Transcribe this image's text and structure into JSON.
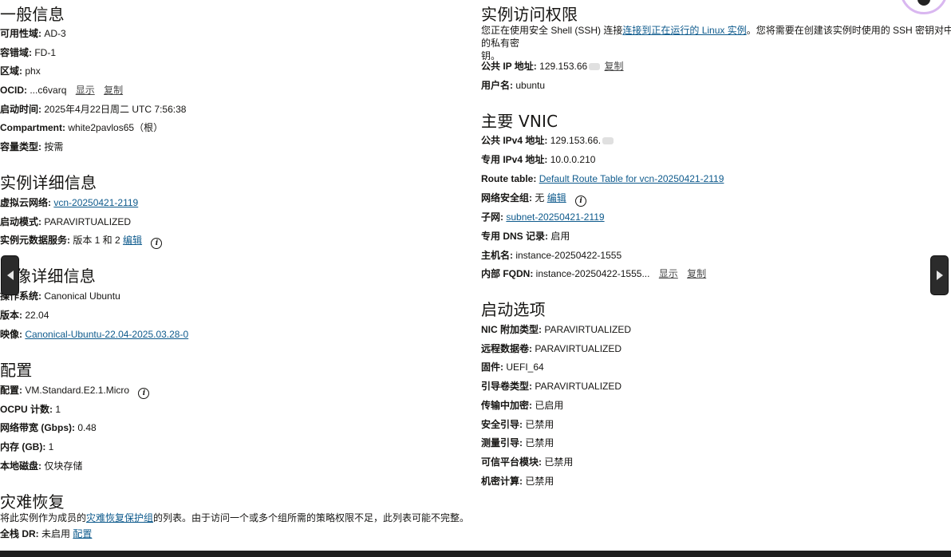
{
  "general": {
    "title": "一般信息",
    "availability_domain_label": "可用性域:",
    "availability_domain_value": "AD-3",
    "fault_domain_label": "容错域:",
    "fault_domain_value": "FD-1",
    "region_label": "区域:",
    "region_value": "phx",
    "ocid_label": "OCID:",
    "ocid_value": "...c6varq",
    "ocid_show": "显示",
    "ocid_copy": "复制",
    "launched_label": "启动时间:",
    "launched_value": "2025年4月22日周二 UTC 7:56:38",
    "compartment_label": "Compartment:",
    "compartment_value": "white2pavlos65（根）",
    "capacity_label": "容量类型:",
    "capacity_value": "按需"
  },
  "instance_details": {
    "title": "实例详细信息",
    "vcn_label": "虚拟云网络:",
    "vcn_value": "vcn-20250421-2119",
    "launch_mode_label": "启动模式:",
    "launch_mode_value": "PARAVIRTUALIZED",
    "metadata_label": "实例元数据服务:",
    "metadata_value": "版本 1 和 2",
    "metadata_edit": "编辑"
  },
  "image_details": {
    "title": "像详细信息",
    "os_label": "操作系统:",
    "os_value": "Canonical Ubuntu",
    "version_label": "版本:",
    "version_value": "22.04",
    "image_label": "映像:",
    "image_value": "Canonical-Ubuntu-22.04-2025.03.28-0"
  },
  "shape": {
    "title": "配置",
    "shape_label": "配置:",
    "shape_value": "VM.Standard.E2.1.Micro",
    "ocpu_label": "OCPU 计数:",
    "ocpu_value": "1",
    "bandwidth_label": "网络带宽 (Gbps):",
    "bandwidth_value": "0.48",
    "memory_label": "内存 (GB):",
    "memory_value": "1",
    "local_disk_label": "本地磁盘:",
    "local_disk_value": "仅块存储"
  },
  "disaster_recovery": {
    "title": "灾难恢复",
    "desc_before": "将此实例作为成员的",
    "desc_link": "灾难恢复保护组",
    "desc_after": "的列表。由于访问一个或多个组所需的策略权限不足，此列表可能不完整。",
    "fsdr_label": "全栈 DR:",
    "fsdr_value": "未启用",
    "fsdr_config": "配置"
  },
  "access": {
    "title": "实例访问权限",
    "desc_before": "您正在使用安全 Shell (SSH) 连接",
    "desc_link": "连接到正在运行的 Linux 实例",
    "desc_after": "。您将需要在创建该实例时使用的 SSH 密钥对中的私有密",
    "desc_line2": "钥。",
    "public_ip_label": "公共 IP 地址:",
    "public_ip_value": "129.153.66",
    "public_ip_copy": "复制",
    "username_label": "用户名:",
    "username_value": "ubuntu"
  },
  "vnic": {
    "title": "主要 VNIC",
    "public_ipv4_label": "公共 IPv4 地址:",
    "public_ipv4_value": "129.153.66.",
    "private_ipv4_label": "专用 IPv4 地址:",
    "private_ipv4_value": "10.0.0.210",
    "route_table_label": "Route table:",
    "route_table_value": "Default Route Table for vcn-20250421-2119",
    "nsg_label": "网络安全组:",
    "nsg_value": "无",
    "nsg_edit": "编辑",
    "subnet_label": "子网:",
    "subnet_value": "subnet-20250421-2119",
    "dns_label": "专用 DNS 记录:",
    "dns_value": "启用",
    "hostname_label": "主机名:",
    "hostname_value": "instance-20250422-1555",
    "fqdn_label": "内部 FQDN:",
    "fqdn_value": "instance-20250422-1555...",
    "fqdn_show": "显示",
    "fqdn_copy": "复制"
  },
  "launch_options": {
    "title": "启动选项",
    "nic_label": "NIC 附加类型:",
    "nic_value": "PARAVIRTUALIZED",
    "remote_vol_label": "远程数据卷:",
    "remote_vol_value": "PARAVIRTUALIZED",
    "firmware_label": "固件:",
    "firmware_value": "UEFI_64",
    "boot_vol_label": "引导卷类型:",
    "boot_vol_value": "PARAVIRTUALIZED",
    "in_transit_label": "传输中加密:",
    "in_transit_value": "已启用",
    "secure_boot_label": "安全引导:",
    "secure_boot_value": "已禁用",
    "measured_boot_label": "测量引导:",
    "measured_boot_value": "已禁用",
    "tpm_label": "可信平台模块:",
    "tpm_value": "已禁用",
    "confidential_label": "机密计算:",
    "confidential_value": "已禁用"
  },
  "icons": {
    "info": "info-icon",
    "prev": "chevron-left-icon",
    "next": "chevron-right-icon"
  }
}
